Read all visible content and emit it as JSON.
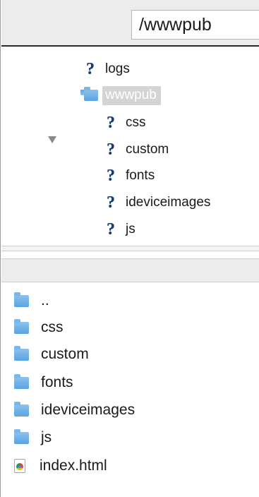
{
  "path_bar": {
    "current_path": "/wwwpub"
  },
  "remote_tree": {
    "items": [
      {
        "label": "logs",
        "icon": "unknown-folder-icon",
        "level": 1
      },
      {
        "label": "wwwpub",
        "icon": "folder-icon",
        "level": 1,
        "expanded": true,
        "selected": true
      },
      {
        "label": "css",
        "icon": "unknown-folder-icon",
        "level": 2
      },
      {
        "label": "custom",
        "icon": "unknown-folder-icon",
        "level": 2
      },
      {
        "label": "fonts",
        "icon": "unknown-folder-icon",
        "level": 2
      },
      {
        "label": "ideviceimages",
        "icon": "unknown-folder-icon",
        "level": 2
      },
      {
        "label": "js",
        "icon": "unknown-folder-icon",
        "level": 2
      }
    ]
  },
  "file_list": {
    "items": [
      {
        "name": "..",
        "icon": "folder-icon"
      },
      {
        "name": "css",
        "icon": "folder-icon"
      },
      {
        "name": "custom",
        "icon": "folder-icon"
      },
      {
        "name": "fonts",
        "icon": "folder-icon"
      },
      {
        "name": "ideviceimages",
        "icon": "folder-icon"
      },
      {
        "name": "js",
        "icon": "folder-icon"
      },
      {
        "name": "index.html",
        "icon": "html-file-icon"
      }
    ]
  },
  "colors": {
    "folder": "#5ba3e0",
    "unknown_icon": "#163b73",
    "selection": "#d4d4d4"
  }
}
